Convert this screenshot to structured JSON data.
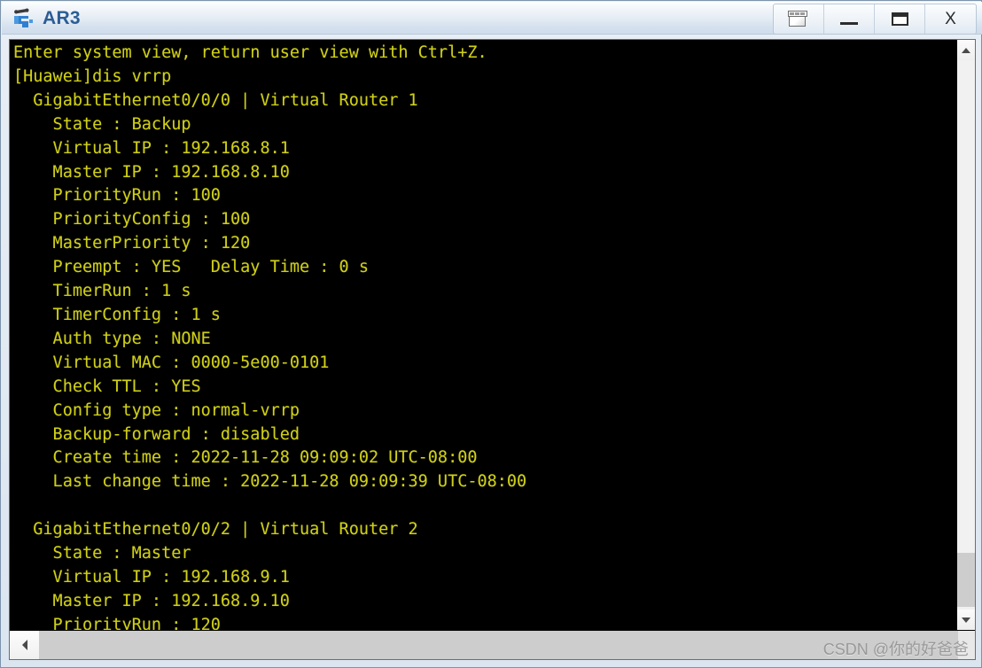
{
  "window": {
    "title": "AR3",
    "app_icon": "router-icon"
  },
  "titlebar_buttons": [
    {
      "name": "cascade-windows-button",
      "icon": "cascade-windows-icon",
      "label": ""
    },
    {
      "name": "minimize-button",
      "icon": "minimize-icon",
      "label": ""
    },
    {
      "name": "maximize-button",
      "icon": "maximize-icon",
      "label": ""
    },
    {
      "name": "close-button",
      "icon": "close-icon",
      "label": "X"
    }
  ],
  "terminal": {
    "foreground_color": "#cfcf19",
    "background_color": "#000000",
    "lines": [
      "Enter system view, return user view with Ctrl+Z.",
      "[Huawei]dis vrrp",
      "  GigabitEthernet0/0/0 | Virtual Router 1",
      "    State : Backup",
      "    Virtual IP : 192.168.8.1",
      "    Master IP : 192.168.8.10",
      "    PriorityRun : 100",
      "    PriorityConfig : 100",
      "    MasterPriority : 120",
      "    Preempt : YES   Delay Time : 0 s",
      "    TimerRun : 1 s",
      "    TimerConfig : 1 s",
      "    Auth type : NONE",
      "    Virtual MAC : 0000-5e00-0101",
      "    Check TTL : YES",
      "    Config type : normal-vrrp",
      "    Backup-forward : disabled",
      "    Create time : 2022-11-28 09:09:02 UTC-08:00",
      "    Last change time : 2022-11-28 09:09:39 UTC-08:00",
      "",
      "  GigabitEthernet0/0/2 | Virtual Router 2",
      "    State : Master",
      "    Virtual IP : 192.168.9.1",
      "    Master IP : 192.168.9.10",
      "    PriorityRun : 120"
    ],
    "text": "Enter system view, return user view with Ctrl+Z.\n[Huawei]dis vrrp\n  GigabitEthernet0/0/0 | Virtual Router 1\n    State : Backup\n    Virtual IP : 192.168.8.1\n    Master IP : 192.168.8.10\n    PriorityRun : 100\n    PriorityConfig : 100\n    MasterPriority : 120\n    Preempt : YES   Delay Time : 0 s\n    TimerRun : 1 s\n    TimerConfig : 1 s\n    Auth type : NONE\n    Virtual MAC : 0000-5e00-0101\n    Check TTL : YES\n    Config type : normal-vrrp\n    Backup-forward : disabled\n    Create time : 2022-11-28 09:09:02 UTC-08:00\n    Last change time : 2022-11-28 09:09:39 UTC-08:00\n\n  GigabitEthernet0/0/2 | Virtual Router 2\n    State : Master\n    Virtual IP : 192.168.9.1\n    Master IP : 192.168.9.10\n    PriorityRun : 120"
  },
  "scrollbars": {
    "vertical": {
      "up_icon": "chevron-up-icon",
      "down_icon": "chevron-down-icon"
    },
    "horizontal": {
      "left_icon": "chevron-left-icon"
    }
  },
  "watermark": {
    "text": "CSDN @你的好爸爸"
  }
}
